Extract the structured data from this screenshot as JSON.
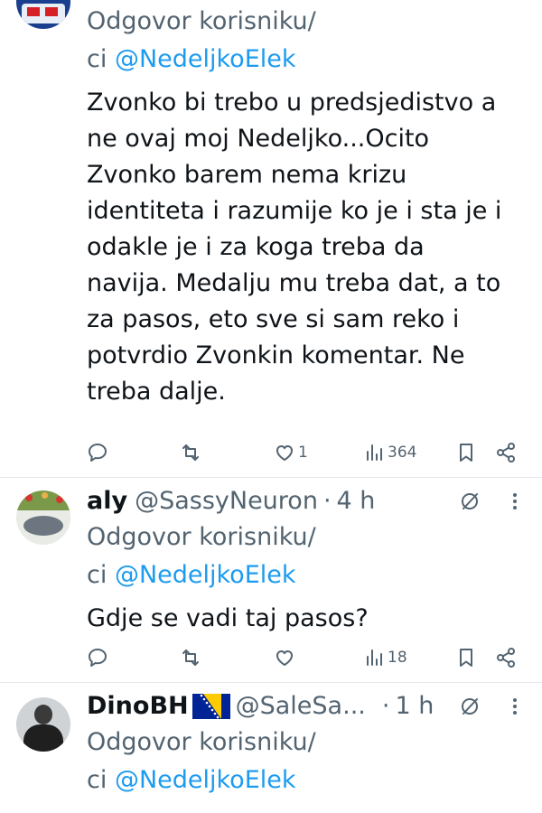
{
  "tweets": [
    {
      "reply_line1": "Odgovor korisniku/",
      "reply_line2_prefix": "ci ",
      "reply_mention": "@NedeljkoElek",
      "text_lines": [
        "Zvonko bi trebo u predsjedistvo a",
        "ne ovaj moj Nedeljko...Ocito",
        "Zvonko barem nema krizu",
        "identiteta i razumije ko je i sta je i",
        "odakle je i za koga treba da",
        "navija. Medalju mu treba dat, a to",
        "za pasos, eto sve si sam reko i",
        "potvrdio Zvonkin komentar. Ne",
        "treba dalje."
      ],
      "likes": "1",
      "views": "364"
    },
    {
      "name": "aly",
      "handle": "@SassyNeuron",
      "dot": "·",
      "time": "4 h",
      "reply_line1": "Odgovor korisniku/",
      "reply_line2_prefix": "ci ",
      "reply_mention": "@NedeljkoElek",
      "text": "Gdje se vadi taj pasos?",
      "likes": "",
      "views": "18"
    },
    {
      "name": "DinoBH",
      "handle": "@SaleSa...",
      "dot": "·",
      "time": "1 h",
      "reply_line1": "Odgovor korisniku/",
      "reply_line2_prefix": "ci ",
      "reply_mention": "@NedeljkoElek"
    }
  ],
  "colors": {
    "accent": "#1d9bf0",
    "muted": "#536471",
    "flag_blue": "#002395",
    "flag_yellow": "#fecb00"
  },
  "icons": [
    "reply-icon",
    "retweet-icon",
    "like-icon",
    "views-icon",
    "bookmark-icon",
    "share-icon",
    "grok-icon",
    "more-icon"
  ]
}
